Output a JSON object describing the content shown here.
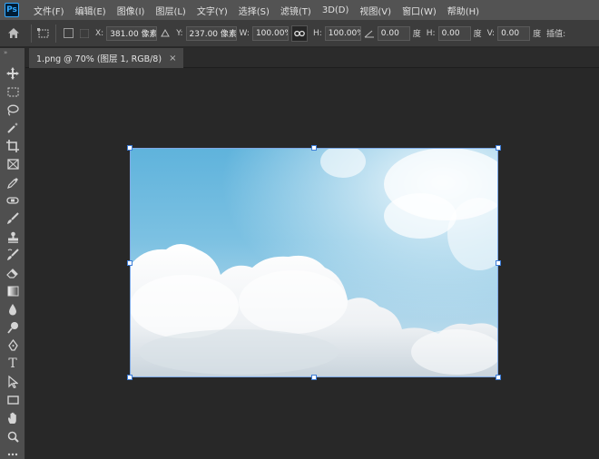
{
  "app": {
    "logo_text": "Ps"
  },
  "menu": [
    "文件(F)",
    "编辑(E)",
    "图像(I)",
    "图层(L)",
    "文字(Y)",
    "选择(S)",
    "滤镜(T)",
    "3D(D)",
    "视图(V)",
    "窗口(W)",
    "帮助(H)"
  ],
  "options": {
    "x_label": "X:",
    "x_value": "381.00 像素",
    "y_label": "Y:",
    "y_value": "237.00 像素",
    "w_label": "W:",
    "w_value": "100.00%",
    "h_label": "H:",
    "h_value": "100.00%",
    "angle_value": "0.00",
    "angle_unit": "度",
    "hskew_label": "H:",
    "hskew_value": "0.00",
    "hskew_unit": "度",
    "vskew_label": "V:",
    "vskew_value": "0.00",
    "vskew_unit": "度",
    "interp_label": "插值:"
  },
  "document_tab": {
    "title": "1.png @ 70% (图层 1, RGB/8)",
    "close": "×"
  },
  "toolbar": {
    "collapse": "»",
    "tools": [
      "move-tool",
      "marquee-tool",
      "lasso-tool",
      "magic-wand-tool",
      "crop-tool",
      "frame-tool",
      "eyedropper-tool",
      "healing-brush-tool",
      "brush-tool",
      "clone-stamp-tool",
      "history-brush-tool",
      "eraser-tool",
      "gradient-tool",
      "blur-tool",
      "dodge-tool",
      "pen-tool",
      "type-tool",
      "path-selection-tool",
      "rectangle-tool",
      "hand-tool",
      "zoom-tool"
    ],
    "type_glyph": "T"
  },
  "colors": {
    "menubar": "#535353",
    "optionsbar": "#3c3c3c",
    "toolbar": "#4f4f4f",
    "canvas_bg": "#282828",
    "accent": "#31a8ff",
    "handle_border": "#3d7dd8"
  }
}
